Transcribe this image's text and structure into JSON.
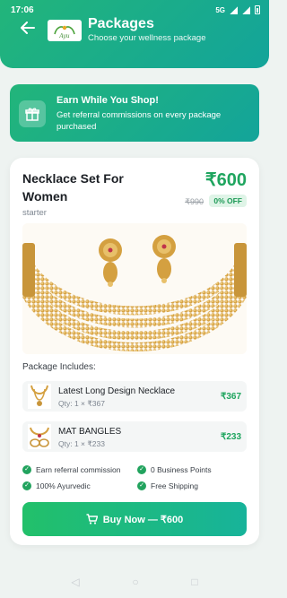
{
  "status_bar": {
    "time": "17:06",
    "network": "5G"
  },
  "header": {
    "title": "Packages",
    "subtitle": "Choose your wellness package",
    "logo_text": "Ayu"
  },
  "banner": {
    "title": "Earn While You Shop!",
    "text": "Get referral commissions on every package purchased",
    "icon": "gift-icon"
  },
  "package": {
    "title": "Necklace Set For Women",
    "tier": "starter",
    "price": "₹600",
    "original_price": "₹990",
    "discount": "0% OFF",
    "includes_label": "Package Includes:",
    "items": [
      {
        "name": "Latest Long Design Necklace",
        "qty": "Qty: 1 × ₹367",
        "price": "₹367"
      },
      {
        "name": "MAT BANGLES",
        "qty": "Qty: 1 × ₹233",
        "price": "₹233"
      }
    ],
    "features": [
      "Earn referral commission",
      "0 Business Points",
      "100% Ayurvedic",
      "Free Shipping"
    ],
    "buy_label": "Buy Now — ₹600"
  },
  "colors": {
    "accent": "#1fa55f",
    "header_start": "#22b57a",
    "header_end": "#13a49a"
  }
}
